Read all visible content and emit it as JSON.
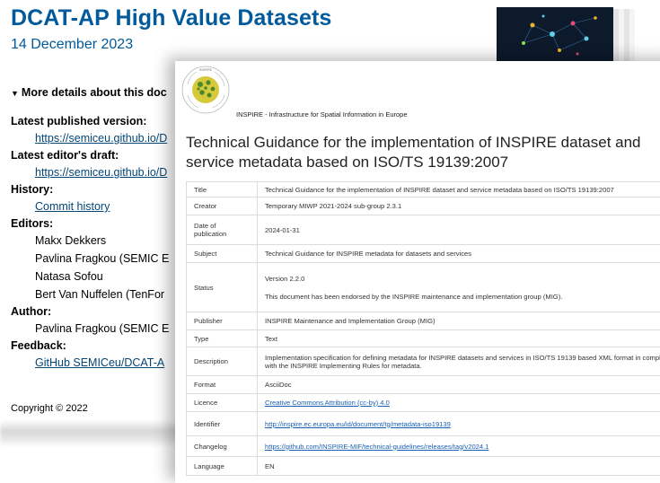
{
  "background_doc": {
    "title": "DCAT-AP High Value Datasets",
    "date": "14 December 2023",
    "details_toggle": "More details about this doc",
    "latest_published_label": "Latest published version:",
    "latest_published_value": "https://semiceu.github.io/D",
    "editors_draft_label": "Latest editor's draft:",
    "editors_draft_value": "https://semiceu.github.io/D",
    "history_label": "History:",
    "history_value": "Commit history",
    "editors_label": "Editors:",
    "editors": [
      "Makx Dekkers",
      "Pavlina Fragkou (SEMIC E",
      "Natasa Sofou",
      "Bert Van Nuffelen (TenFor"
    ],
    "author_label": "Author:",
    "author_value": "Pavlina Fragkou (SEMIC E",
    "feedback_label": "Feedback:",
    "feedback_value": "GitHub SEMICeu/DCAT-A",
    "copyright": "Copyright © 2022"
  },
  "foreground_doc": {
    "org_line": "INSPIRE - Infrastructure for Spatial Information in Europe",
    "logo_text": "INSPIRE",
    "title": "Technical Guidance for the implementation of INSPIRE dataset and service metadata based on ISO/TS 19139:2007",
    "rows": {
      "title": {
        "key": "Title",
        "value": "Technical Guidance for the implementation of INSPIRE dataset and service metadata based on ISO/TS 19139:2007"
      },
      "creator": {
        "key": "Creator",
        "value": "Temporary MIWP 2021-2024 sub-group 2.3.1"
      },
      "date": {
        "key": "Date of publication",
        "value": "2024-01-31"
      },
      "subject": {
        "key": "Subject",
        "value": "Technical Guidance for INSPIRE metadata for datasets and services"
      },
      "status": {
        "key": "Status",
        "value_version": "Version 2.2.0",
        "value_note": "This document has been endorsed by the INSPIRE maintenance and implementation group (MIG)."
      },
      "publisher": {
        "key": "Publisher",
        "value": "INSPIRE Maintenance and Implementation Group (MIG)"
      },
      "type": {
        "key": "Type",
        "value": "Text"
      },
      "description": {
        "key": "Description",
        "value": "Implementation specification for defining metadata for INSPIRE datasets and services in ISO/TS 19139 based XML format in compliance with the INSPIRE Implementing Rules for metadata."
      },
      "format": {
        "key": "Format",
        "value": "AsciiDoc"
      },
      "licence": {
        "key": "Licence",
        "value": "Creative Commons Attribution (cc-by) 4.0"
      },
      "identifier": {
        "key": "Identifier",
        "value": "http://inspire.ec.europa.eu/id/document/tg/metadata-iso19139"
      },
      "changelog": {
        "key": "Changelog",
        "value": "https://github.com/INSPIRE-MIF/technical-guidelines/releases/tag/v2024.1"
      },
      "language": {
        "key": "Language",
        "value": "EN"
      }
    }
  },
  "colors": {
    "dcat_blue": "#005a9c",
    "link_blue": "#034575",
    "inspire_yellow": "#d8c93a",
    "inspire_green": "#4a8a2a"
  }
}
